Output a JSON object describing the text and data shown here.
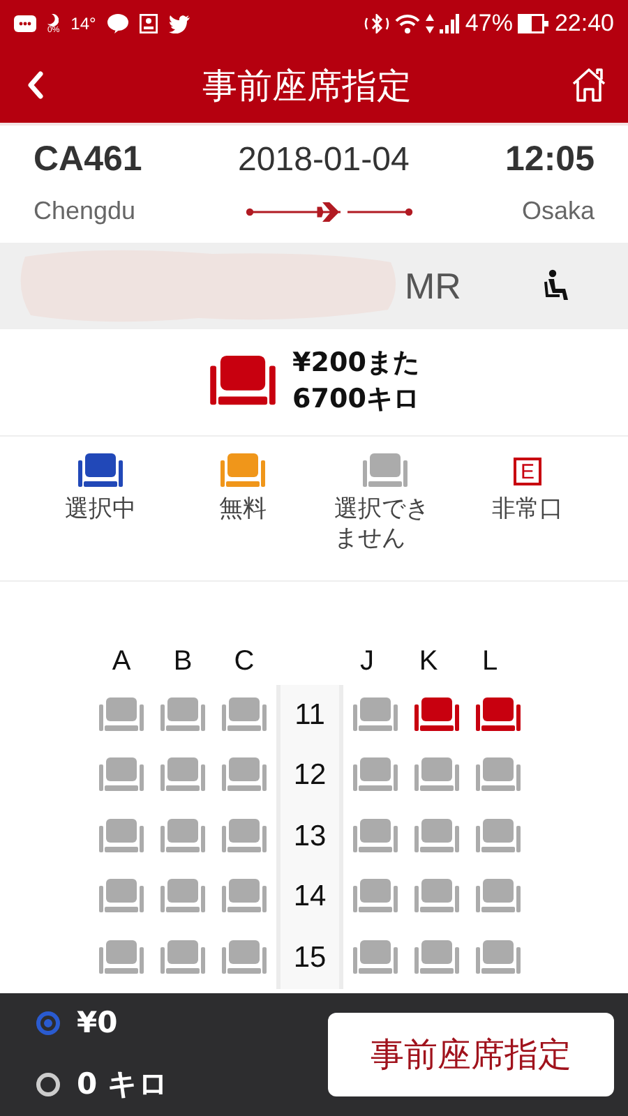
{
  "status_bar": {
    "moon_percent": "0%",
    "temperature": "14°",
    "battery": "47%",
    "time": "22:40"
  },
  "header": {
    "title": "事前座席指定"
  },
  "flight": {
    "number": "CA461",
    "date": "2018-01-04",
    "time": "12:05",
    "from": "Chengdu",
    "to": "Osaka"
  },
  "passenger": {
    "title": "MR"
  },
  "price": {
    "lines": [
      "¥200また",
      "6700キロ"
    ]
  },
  "legend": [
    {
      "kind": "selected",
      "label": "選択中"
    },
    {
      "kind": "free",
      "label": "無料"
    },
    {
      "kind": "unavailable",
      "label": "選択できません"
    },
    {
      "kind": "exit",
      "badge": "E",
      "label": "非常口"
    }
  ],
  "seat_map": {
    "columns_left": [
      "A",
      "B",
      "C"
    ],
    "columns_right": [
      "J",
      "K",
      "L"
    ],
    "rows": [
      {
        "number": "11",
        "left": [
          {
            "kind": "unavailable"
          },
          {
            "kind": "unavailable"
          },
          {
            "kind": "unavailable"
          }
        ],
        "right": [
          {
            "kind": "unavailable"
          },
          {
            "kind": "paid"
          },
          {
            "kind": "paid"
          }
        ]
      },
      {
        "number": "12",
        "left": [
          {
            "kind": "unavailable"
          },
          {
            "kind": "unavailable"
          },
          {
            "kind": "unavailable"
          }
        ],
        "right": [
          {
            "kind": "unavailable"
          },
          {
            "kind": "unavailable"
          },
          {
            "kind": "unavailable"
          }
        ]
      },
      {
        "number": "13",
        "left": [
          {
            "kind": "unavailable"
          },
          {
            "kind": "unavailable"
          },
          {
            "kind": "unavailable"
          }
        ],
        "right": [
          {
            "kind": "unavailable"
          },
          {
            "kind": "unavailable"
          },
          {
            "kind": "unavailable"
          }
        ]
      },
      {
        "number": "14",
        "left": [
          {
            "kind": "unavailable"
          },
          {
            "kind": "unavailable"
          },
          {
            "kind": "unavailable"
          }
        ],
        "right": [
          {
            "kind": "unavailable"
          },
          {
            "kind": "unavailable"
          },
          {
            "kind": "unavailable"
          }
        ]
      },
      {
        "number": "15",
        "left": [
          {
            "kind": "unavailable"
          },
          {
            "kind": "unavailable"
          },
          {
            "kind": "unavailable"
          }
        ],
        "right": [
          {
            "kind": "unavailable"
          },
          {
            "kind": "unavailable"
          },
          {
            "kind": "unavailable"
          }
        ]
      }
    ]
  },
  "footer": {
    "options": [
      {
        "label": "¥0",
        "selected": true
      },
      {
        "label": "0 キロ",
        "selected": false
      }
    ],
    "button": "事前座席指定"
  }
}
